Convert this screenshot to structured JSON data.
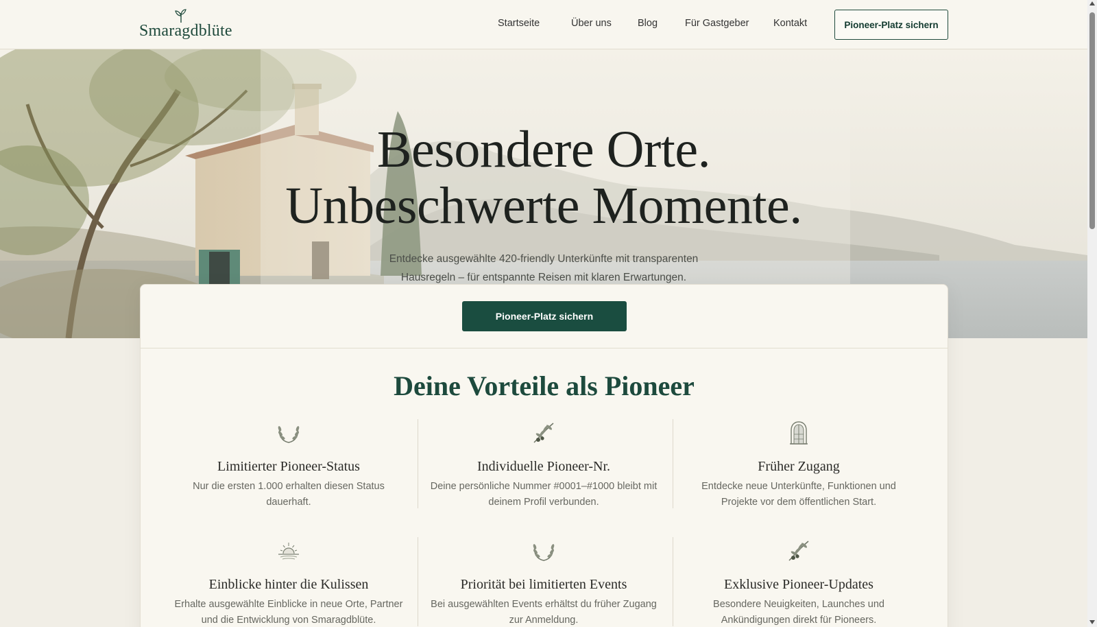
{
  "header": {
    "logo_text": "Smaragdblüte",
    "nav": [
      {
        "label": "Startseite"
      },
      {
        "label": "Über uns"
      },
      {
        "label": "Blog"
      },
      {
        "label": "Für Gastgeber"
      },
      {
        "label": "Kontakt"
      }
    ],
    "cta_label": "Pioneer-Platz sichern"
  },
  "hero": {
    "title_line1": "Besondere Orte.",
    "title_line2": "Unbeschwerte Momente.",
    "subtitle": "Entdecke ausgewählte 420-friendly Unterkünfte mit transparenten Hausregeln – für entspannte Reisen mit klaren Erwartungen.",
    "image": "mediterranean-villa-olive-tree-sea"
  },
  "card": {
    "cta_label": "Pioneer-Platz sichern",
    "benefits_title": "Deine Vorteile als Pioneer",
    "benefits": [
      {
        "icon": "laurel-wreath-icon",
        "title": "Limitierter Pioneer-Status",
        "text": "Nur die ersten 1.000 erhalten diesen Status dauerhaft."
      },
      {
        "icon": "olive-branch-icon",
        "title": "Individuelle Pioneer-Nr.",
        "text": "Deine persönliche Nummer #0001–#1000 bleibt mit deinem Profil verbunden."
      },
      {
        "icon": "arched-door-icon",
        "title": "Früher Zugang",
        "text": "Entdecke neue Unterkünfte, Funktionen und Projekte vor dem öffentlichen Start."
      },
      {
        "icon": "sunrise-icon",
        "title": "Einblicke hinter die Kulissen",
        "text": "Erhalte ausgewählte Einblicke in neue Orte, Partner und die Entwicklung von Smaragdblüte."
      },
      {
        "icon": "laurel-wreath-icon",
        "title": "Priorität bei limitierten Events",
        "text": "Bei ausgewählten Events erhältst du früher Zugang zur Anmeldung."
      },
      {
        "icon": "olive-branch-icon",
        "title": "Exklusive Pioneer-Updates",
        "text": "Besondere Neuigkeiten, Launches und Ankündigungen direkt für Pioneers."
      }
    ]
  },
  "colors": {
    "brand_green": "#1a4d40",
    "background": "#f1eee6",
    "card_background": "#f9f7f0"
  }
}
